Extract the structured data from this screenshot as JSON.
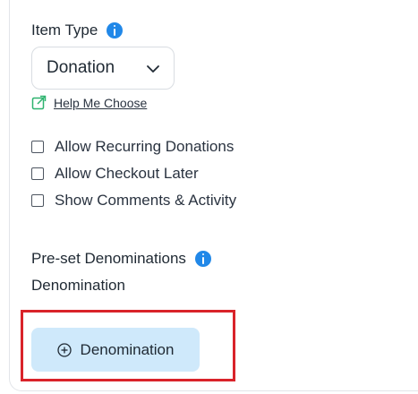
{
  "item_type": {
    "label": "Item Type",
    "selected_value": "Donation",
    "help_link": "Help Me Choose"
  },
  "options": [
    {
      "label": "Allow Recurring Donations",
      "checked": false
    },
    {
      "label": "Allow Checkout Later",
      "checked": false
    },
    {
      "label": "Show Comments & Activity",
      "checked": false
    }
  ],
  "denominations": {
    "section_label": "Pre-set Denominations",
    "sub_label": "Denomination",
    "add_button_label": "Denomination"
  },
  "colors": {
    "info_icon": "#2188e8",
    "help_icon": "#2db36f",
    "button_bg": "#cfe9fb",
    "highlight_border": "#d9232a"
  }
}
